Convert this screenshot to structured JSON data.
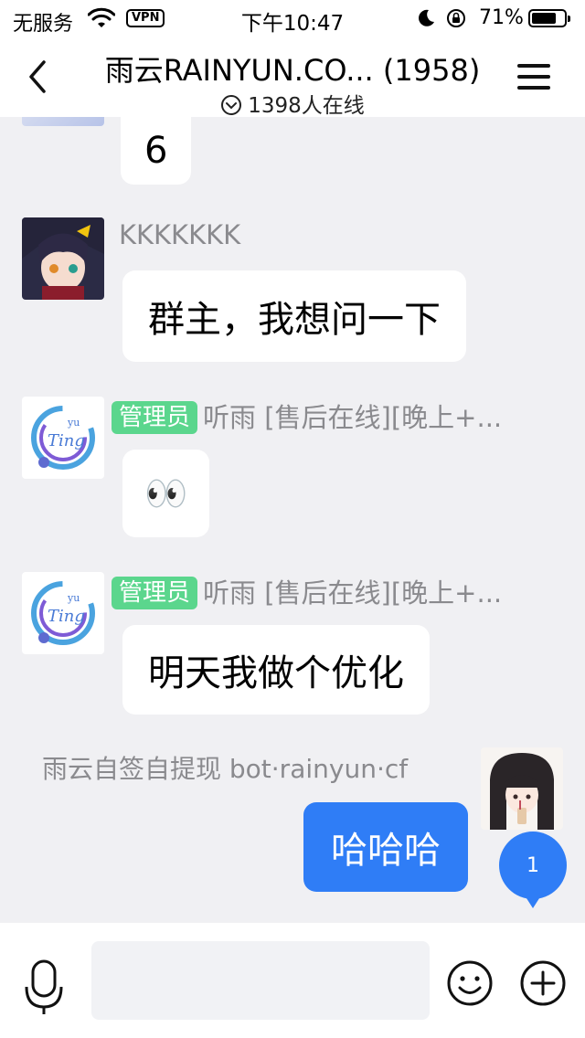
{
  "status_bar": {
    "carrier": "无服务",
    "vpn": "VPN",
    "time": "下午10:47",
    "battery": "71%",
    "battery_level": 0.71
  },
  "header": {
    "title": "雨云RAINYUN.CO... (1958)",
    "online": "1398人在线"
  },
  "messages": [
    {
      "text": "6"
    },
    {
      "sender": "KKKKKKK",
      "text": "群主，我想问一下"
    },
    {
      "role": "管理员",
      "sender": "听雨 [售后在线][晚上+...",
      "text": "👀"
    },
    {
      "role": "管理员",
      "sender": "听雨 [售后在线][晚上+...",
      "text": "明天我做个优化"
    },
    {
      "sender": "雨云自签自提现 bot·rainyun·cf",
      "text": "哈哈哈",
      "outgoing": true
    }
  ],
  "unread_count": "1",
  "input": {
    "placeholder": ""
  },
  "icons": {
    "back": "chevron-left-icon",
    "menu": "hamburger-menu-icon",
    "mic": "microphone-icon",
    "emoji": "smiley-icon",
    "plus": "plus-circle-icon"
  },
  "colors": {
    "accent": "#2f7df6",
    "admin_badge": "#5bd68d",
    "background": "#f0f0f3"
  }
}
